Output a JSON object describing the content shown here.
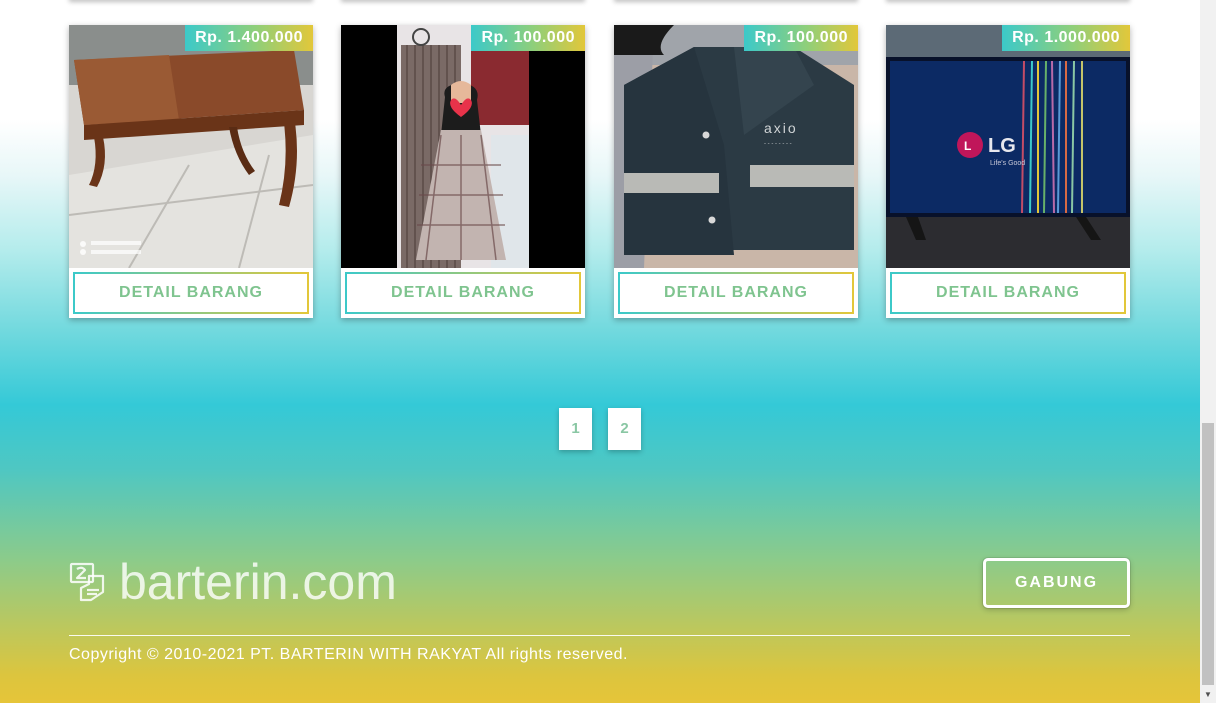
{
  "products": [
    {
      "price": "Rp. 1.400.000",
      "button_label": "DETAIL BARANG",
      "image": "wooden-table-photo"
    },
    {
      "price": "Rp. 100.000",
      "button_label": "DETAIL BARANG",
      "image": "dress-photo"
    },
    {
      "price": "Rp. 100.000",
      "button_label": "DETAIL BARANG",
      "image": "raincoat-photo"
    },
    {
      "price": "Rp. 1.000.000",
      "button_label": "DETAIL BARANG",
      "image": "lg-tv-photo"
    }
  ],
  "pagination": {
    "pages": [
      "1",
      "2"
    ],
    "current": "1"
  },
  "footer": {
    "logo_text": "barterin.com",
    "join_label": "GABUNG",
    "copyright": "Copyright © 2010-2021 PT. BARTERIN WITH RAKYAT All rights reserved."
  },
  "colors": {
    "gradient_teal": "#3cc9c9",
    "gradient_yellow": "#e2c73a",
    "button_text": "#7fc48f"
  }
}
